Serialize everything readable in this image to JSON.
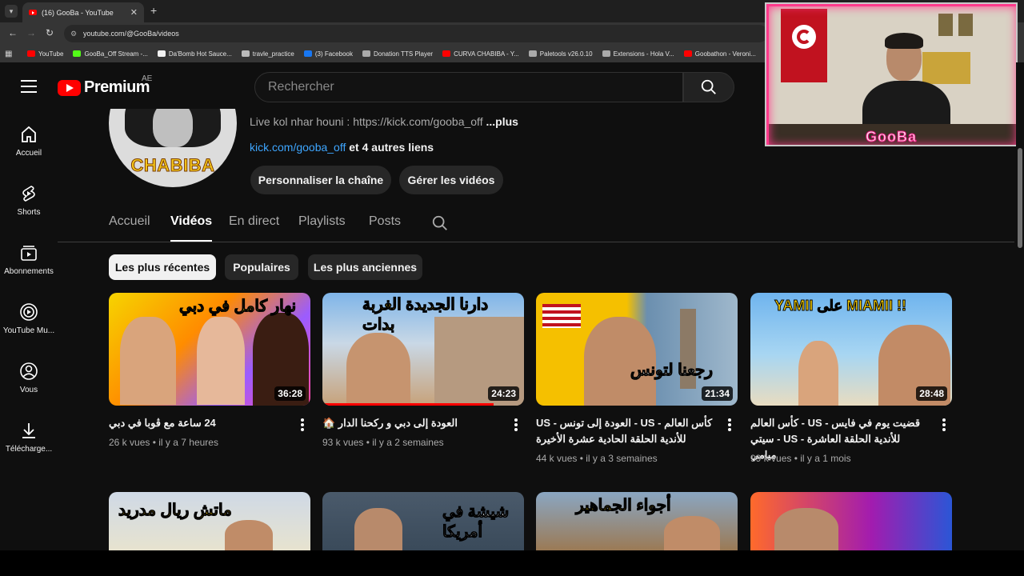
{
  "browser": {
    "tab_title": "(16) GooBa - YouTube",
    "url": "youtube.com/@GooBa/videos",
    "bookmarks": [
      {
        "label": "YouTube",
        "color": "#ff0000"
      },
      {
        "label": "GooBa_Off Stream -...",
        "color": "#53fc18"
      },
      {
        "label": "Da'Bomb Hot Sauce...",
        "color": "#f1f1f1"
      },
      {
        "label": "travle_practice",
        "color": "#bbbbbb"
      },
      {
        "label": "(3) Facebook",
        "color": "#1877f2"
      },
      {
        "label": "Donation TTS Player",
        "color": "#aaaaaa"
      },
      {
        "label": "CURVA CHABIBA - Y...",
        "color": "#ff0000"
      },
      {
        "label": "Paletools v26.0.10",
        "color": "#aaaaaa"
      },
      {
        "label": "Extensions - Hola V...",
        "color": "#aaaaaa"
      },
      {
        "label": "Goobathon - Veroni...",
        "color": "#ff0000"
      }
    ]
  },
  "header": {
    "logo_text": "Premium",
    "country_code": "AE",
    "search_placeholder": "Rechercher"
  },
  "rail": [
    {
      "label": "Accueil",
      "icon": "home-icon"
    },
    {
      "label": "Shorts",
      "icon": "shorts-icon"
    },
    {
      "label": "Abonnements",
      "icon": "subscriptions-icon"
    },
    {
      "label": "YouTube Mu...",
      "icon": "youtube-music-icon"
    },
    {
      "label": "Vous",
      "icon": "you-icon"
    },
    {
      "label": "Télécharge...",
      "icon": "download-icon"
    }
  ],
  "channel": {
    "avatar_text": "CHABIBA",
    "description": "Live kol nhar houni : https://kick.com/gooba_off",
    "more": "...plus",
    "link": "kick.com/gooba_off",
    "link_more": "et 4 autres liens",
    "customize_button": "Personnaliser la chaîne",
    "manage_button": "Gérer les vidéos"
  },
  "tabs": [
    "Accueil",
    "Vidéos",
    "En direct",
    "Playlists",
    "Posts"
  ],
  "active_tab": "Vidéos",
  "chips": [
    "Les plus récentes",
    "Populaires",
    "Les plus anciennes"
  ],
  "videos": [
    {
      "title": "24 ساعة مع ڤوبا في دبي",
      "views": "26 k vues",
      "age": "il y a 7 heures",
      "duration": "36:28",
      "progress": 0.0
    },
    {
      "title": "العودة إلى دبي و ركحنا الدار 🏠",
      "views": "93 k vues",
      "age": "il y a 2 semaines",
      "duration": "24:23",
      "progress": 0.85
    },
    {
      "title": "US - العودة إلى تونس - US - كأس العالم للأندية الحلقة الحادية عشرة الأخيرة",
      "views": "44 k vues",
      "age": "il y a 3 semaines",
      "duration": "21:34",
      "progress": 0.0
    },
    {
      "title": "قضيت يوم في فايس - US - كأس العالم للأندية الحلقة العاشرة - US - سيتي ميامي",
      "views": "99 k vues",
      "age": "il y a 1 mois",
      "duration": "28:48",
      "progress": 0.0
    }
  ],
  "thumb_text": [
    "نهار كامل في دبي",
    "دارنا الجديدة الغربة بدات",
    "رجعنا لتونس",
    "YAMII على MIAMII !!",
    "ماتش ريال مدريد",
    "شيشة في أمريكا",
    "أجواء الجماهير",
    ""
  ],
  "cam_overlay_text": "GooBa"
}
